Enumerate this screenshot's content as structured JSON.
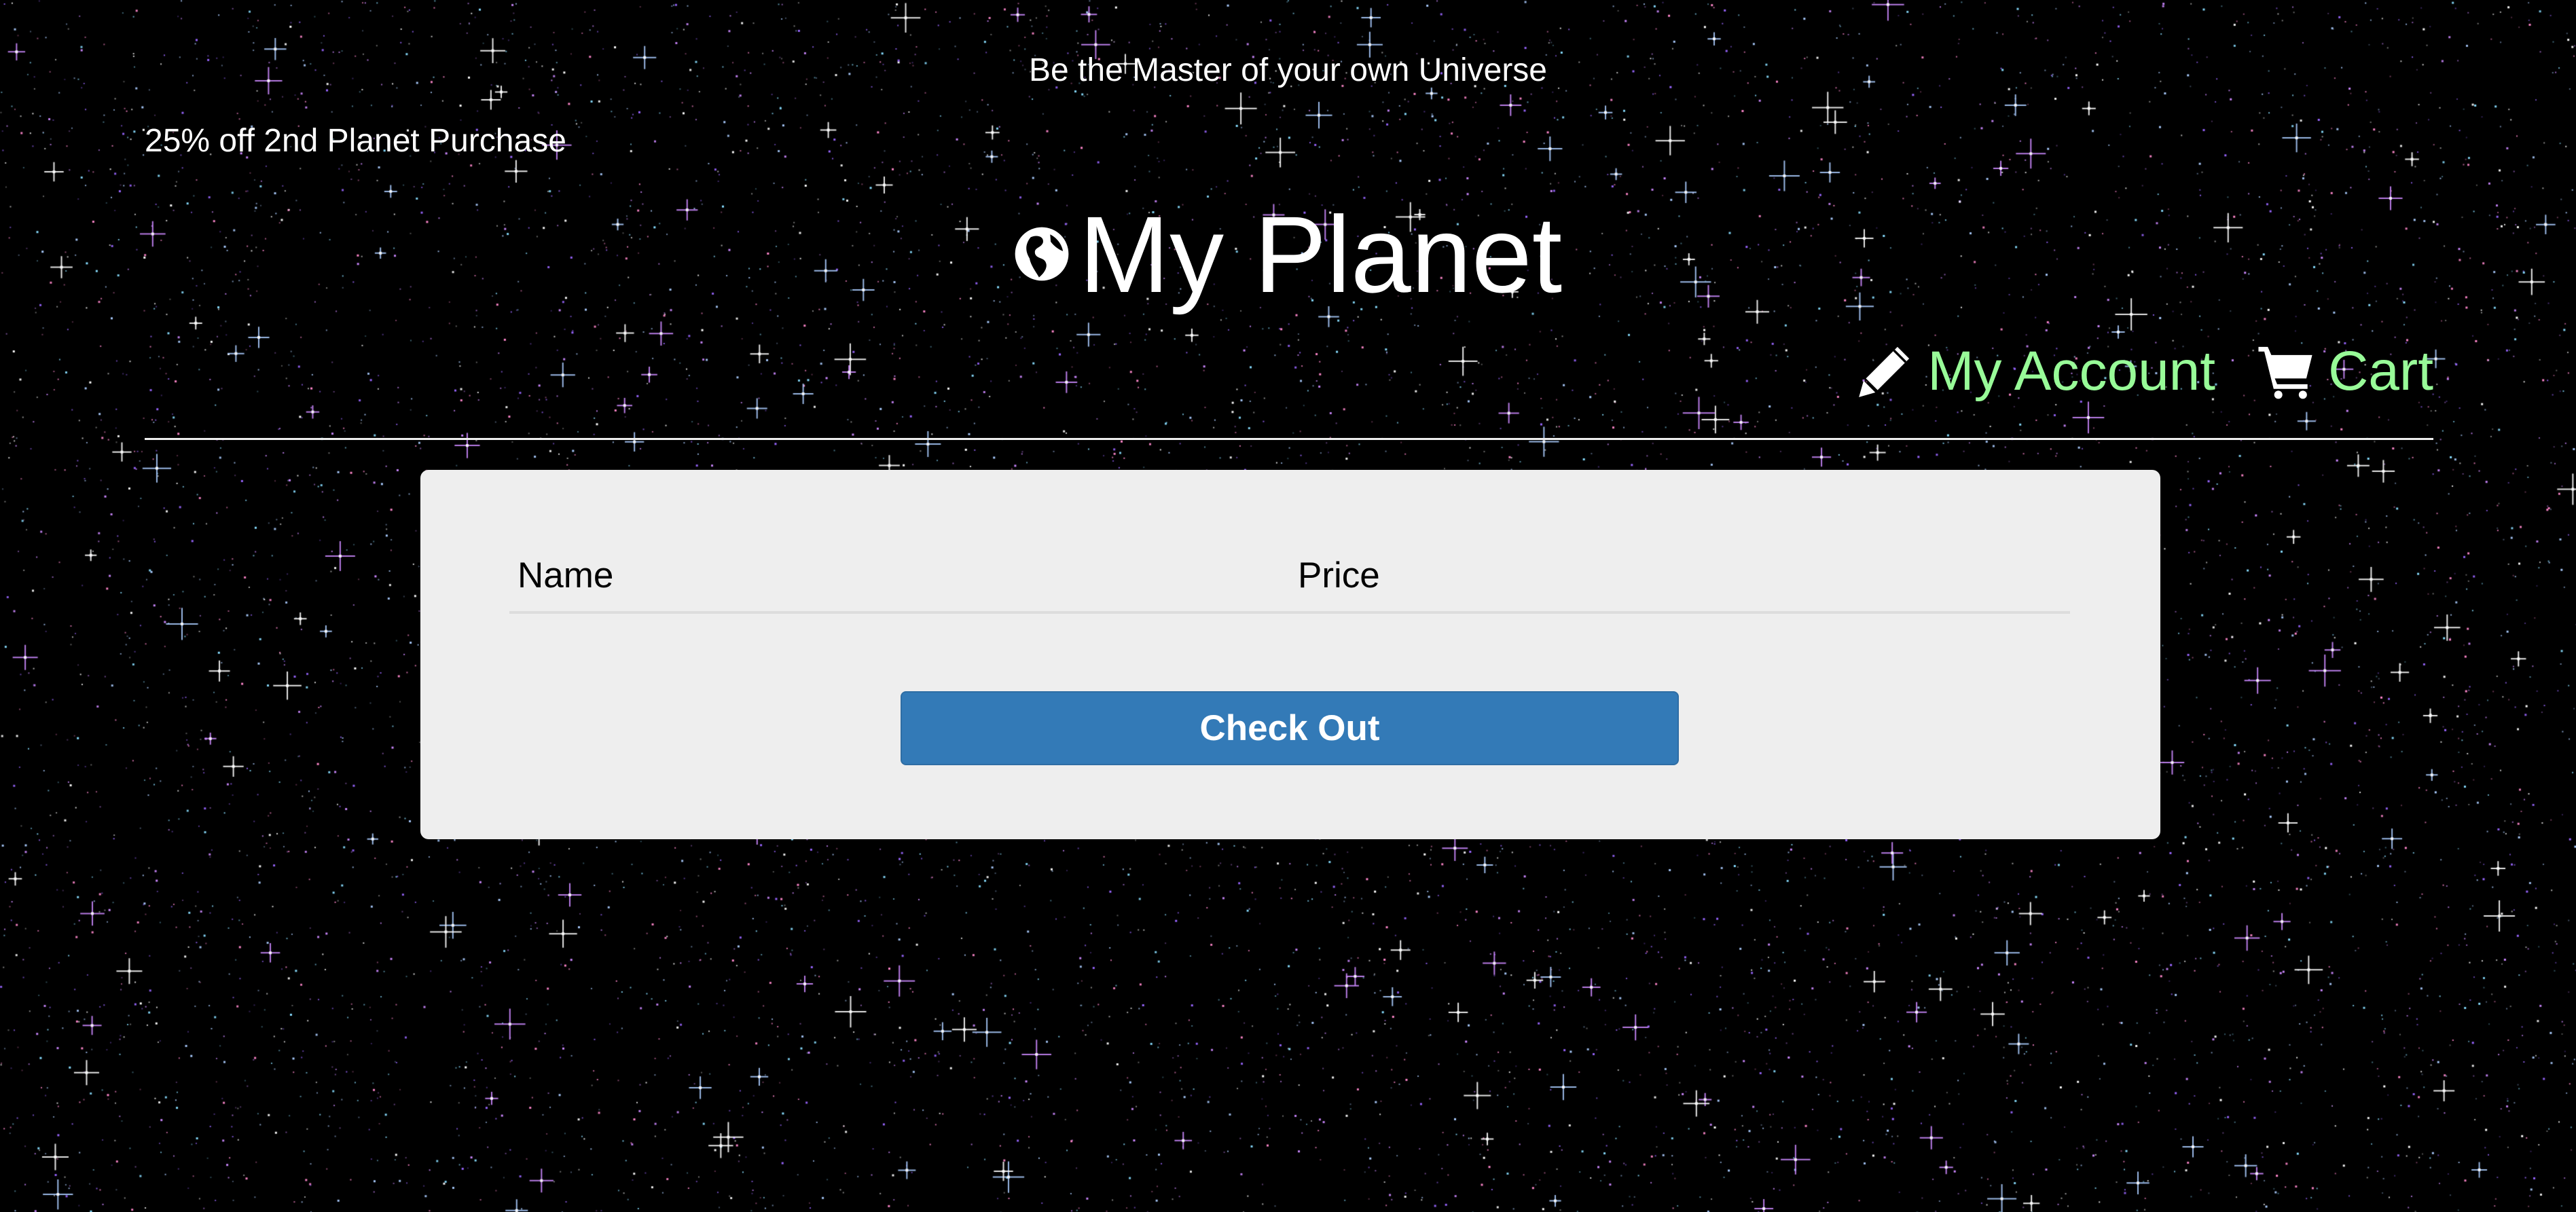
{
  "header": {
    "tagline": "Be the Master of your own Universe",
    "promo": "25% off 2nd Planet Purchase",
    "title": "My Planet",
    "title_icon": "globe-icon"
  },
  "nav": {
    "account": {
      "label": "My Account",
      "icon": "pencil-icon"
    },
    "cart": {
      "label": "Cart",
      "icon": "cart-icon"
    }
  },
  "cart_table": {
    "columns": [
      "Name",
      "Price"
    ],
    "rows": []
  },
  "checkout_label": "Check Out",
  "colors": {
    "nav_link": "#98fb98",
    "button": "#337ab7",
    "panel": "#eeeeee",
    "background": "#000000"
  }
}
